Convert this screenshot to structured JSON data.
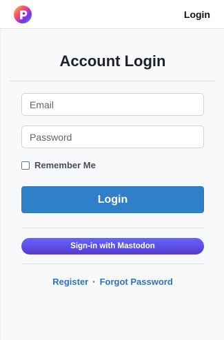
{
  "header": {
    "logo_icon": "colorful-circle-logo-icon",
    "nav_login_label": "Login"
  },
  "main": {
    "title": "Account Login",
    "email_placeholder": "Email",
    "password_placeholder": "Password",
    "remember_label": "Remember Me",
    "login_button_label": "Login",
    "mastodon_button_label": "Sign-in with Mastodon",
    "register_label": "Register",
    "separator": "·",
    "forgot_label": "Forgot Password"
  },
  "colors": {
    "primary": "#2f7fc9",
    "mastodon_top": "#6364ff",
    "mastodon_bottom": "#563acc",
    "link": "#2f73b8"
  }
}
